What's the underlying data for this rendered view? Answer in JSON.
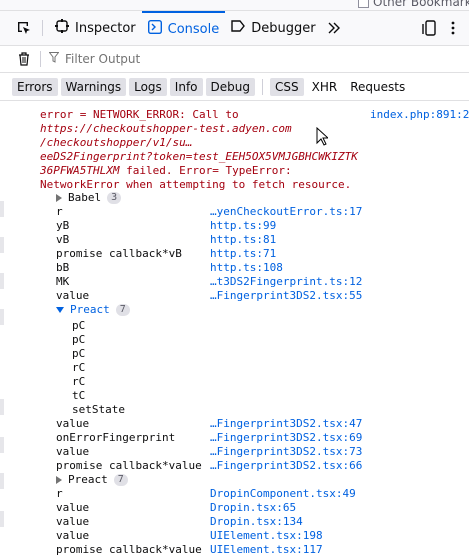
{
  "browser": {
    "bookmark_label": "Other Bookmarks"
  },
  "toolbar": {
    "tabs": [
      {
        "label": "Inspector",
        "icon": "inspector-icon"
      },
      {
        "label": "Console",
        "icon": "console-icon",
        "active": true
      },
      {
        "label": "Debugger",
        "icon": "debugger-icon"
      }
    ]
  },
  "filter": {
    "placeholder": "Filter Output"
  },
  "categories": [
    "Errors",
    "Warnings",
    "Logs",
    "Info",
    "Debug"
  ],
  "requests_categories": [
    "CSS",
    "XHR",
    "Requests"
  ],
  "error": {
    "line1": "error = NETWORK_ERROR: Call to",
    "url1": "https://checkoutshopper-test.adyen.com",
    "url2": "/checkoutshopper/v1/su…",
    "url3": "eeDS2Fingerprint?token=test_EEH5OX5VMJGBHCWKIZTK",
    "url4": "36PFWA5THLXM",
    "tail": " failed. Error= TypeError:",
    "line6": "NetworkError when attempting to fetch resource.",
    "source": "index.php:891:2"
  },
  "stack": {
    "babel": {
      "name": "Babel",
      "count": "3"
    },
    "frames1": [
      {
        "fn": "r",
        "loc": "…yenCheckoutError.ts:17"
      },
      {
        "fn": "yB",
        "loc": "http.ts:99"
      },
      {
        "fn": "vB",
        "loc": "http.ts:81"
      },
      {
        "fn": "promise callback*vB",
        "loc": "http.ts:71"
      },
      {
        "fn": "bB",
        "loc": "http.ts:108"
      },
      {
        "fn": "MK",
        "loc": "…t3DS2Fingerprint.ts:12"
      },
      {
        "fn": "value",
        "loc": "…Fingerprint3DS2.tsx:55"
      }
    ],
    "preact_open": {
      "name": "Preact",
      "count": "7"
    },
    "preact_items": [
      "pC",
      "pC",
      "pC",
      "rC",
      "rC",
      "tC",
      "setState"
    ],
    "frames2": [
      {
        "fn": "value",
        "loc": "…Fingerprint3DS2.tsx:47"
      },
      {
        "fn": "onErrorFingerprint",
        "loc": "…Fingerprint3DS2.tsx:69"
      },
      {
        "fn": "value",
        "loc": "…Fingerprint3DS2.tsx:73"
      },
      {
        "fn": "promise callback*value",
        "loc": "…Fingerprint3DS2.tsx:66"
      }
    ],
    "preact_closed": {
      "name": "Preact",
      "count": "7"
    },
    "frames3": [
      {
        "fn": "r",
        "loc": "DropinComponent.tsx:49"
      },
      {
        "fn": "value",
        "loc": "Dropin.tsx:65"
      },
      {
        "fn": "value",
        "loc": "Dropin.tsx:134"
      },
      {
        "fn": "value",
        "loc": "UIElement.tsx:198"
      },
      {
        "fn": "promise callback*value",
        "loc": "UIElement.tsx:117"
      }
    ]
  }
}
